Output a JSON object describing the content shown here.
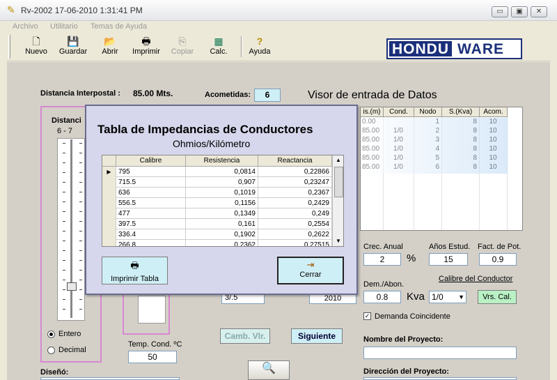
{
  "window": {
    "title": "Rv-2002  17-06-2010  1:31:41 PM",
    "controls": [
      "▭",
      "▣",
      "✕"
    ]
  },
  "menu": [
    "Archivo",
    "Utilitario",
    "Temas de Ayuda"
  ],
  "toolbar": [
    {
      "label": "Nuevo",
      "icon": "new-file-icon"
    },
    {
      "label": "Guardar",
      "icon": "save-icon"
    },
    {
      "label": "Abrir",
      "icon": "open-folder-icon"
    },
    {
      "label": "Imprimir",
      "icon": "printer-icon"
    },
    {
      "label": "Copiar",
      "icon": "copy-icon",
      "disabled": true
    },
    {
      "label": "Calc.",
      "icon": "calculator-icon"
    },
    {
      "label": "Ayuda",
      "icon": "help-icon"
    }
  ],
  "logo": {
    "left": "HONDU",
    "right": "WARE"
  },
  "main": {
    "distancia_label": "Distancia Interpostal :",
    "distancia_value": "85.00 Mts.",
    "acometidas_label": "Acometidas:",
    "acometidas_value": "6",
    "visor_title": "Visor  de entrada de Datos",
    "left_panel_label": "Distanci",
    "left_panel_range": "6  -  7",
    "entero": "Entero",
    "decimal": "Decimal",
    "temp_label": "Temp. Cond. ºC",
    "temp_value": "50",
    "diseno": "Diseñó:",
    "camb_btn": "Camb. Vlr.",
    "siguiente_btn": "Siguiente",
    "crec_label": "Crec. Anual",
    "crec_value": "2",
    "pct": "%",
    "anos_label": "Años Estud.",
    "anos_value": "15",
    "fact_label": "Fact. de Pot.",
    "fact_value": "0.9",
    "dem_label": "Dem./Abon.",
    "dem_value": "0.8",
    "kva": "Kva",
    "calibre_label": "Calibre del Conductor",
    "calibre_value": "1/0",
    "vrs_btn": "Vrs. Cal.",
    "demanda_coincidente": "Demanda Coincidente",
    "nombre_label": "Nombre del Proyecto:",
    "direccion_label": "Dirección del Proyecto:",
    "partial_combo": "3/.5",
    "partial_box": "2010"
  },
  "grid": {
    "headers": [
      "is.(m)",
      "Cond.",
      "Nodo",
      "S.(Kva)",
      "Acom."
    ],
    "rows": [
      [
        "0.00",
        "",
        "1",
        "8",
        "10"
      ],
      [
        "85.00",
        "1/0",
        "2",
        "8",
        "10"
      ],
      [
        "85.00",
        "1/0",
        "3",
        "8",
        "10"
      ],
      [
        "85.00",
        "1/0",
        "4",
        "8",
        "10"
      ],
      [
        "85.00",
        "1/0",
        "5",
        "8",
        "10"
      ],
      [
        "85.00",
        "1/0",
        "6",
        "8",
        "10"
      ]
    ]
  },
  "dialog": {
    "title": "Tabla de Impedancias de Conductores",
    "subtitle": "Ohmios/Kilómetro",
    "headers": [
      "Calibre",
      "Resistencia",
      "Reactancia"
    ],
    "rows": [
      [
        "795",
        "0,0814",
        "0,22866"
      ],
      [
        "715.5",
        "0,907",
        "0,23247"
      ],
      [
        "636",
        "0,1019",
        "0,2367"
      ],
      [
        "556.5",
        "0,1156",
        "0,2429"
      ],
      [
        "477",
        "0,1349",
        "0,249"
      ],
      [
        "397.5",
        "0,161",
        "0,2554"
      ],
      [
        "336.4",
        "0,1902",
        "0,2622"
      ],
      [
        "266.8",
        "0,2362",
        "0,27515"
      ]
    ],
    "print_btn": "Imprimir Tabla",
    "close_btn": "Cerrar"
  }
}
